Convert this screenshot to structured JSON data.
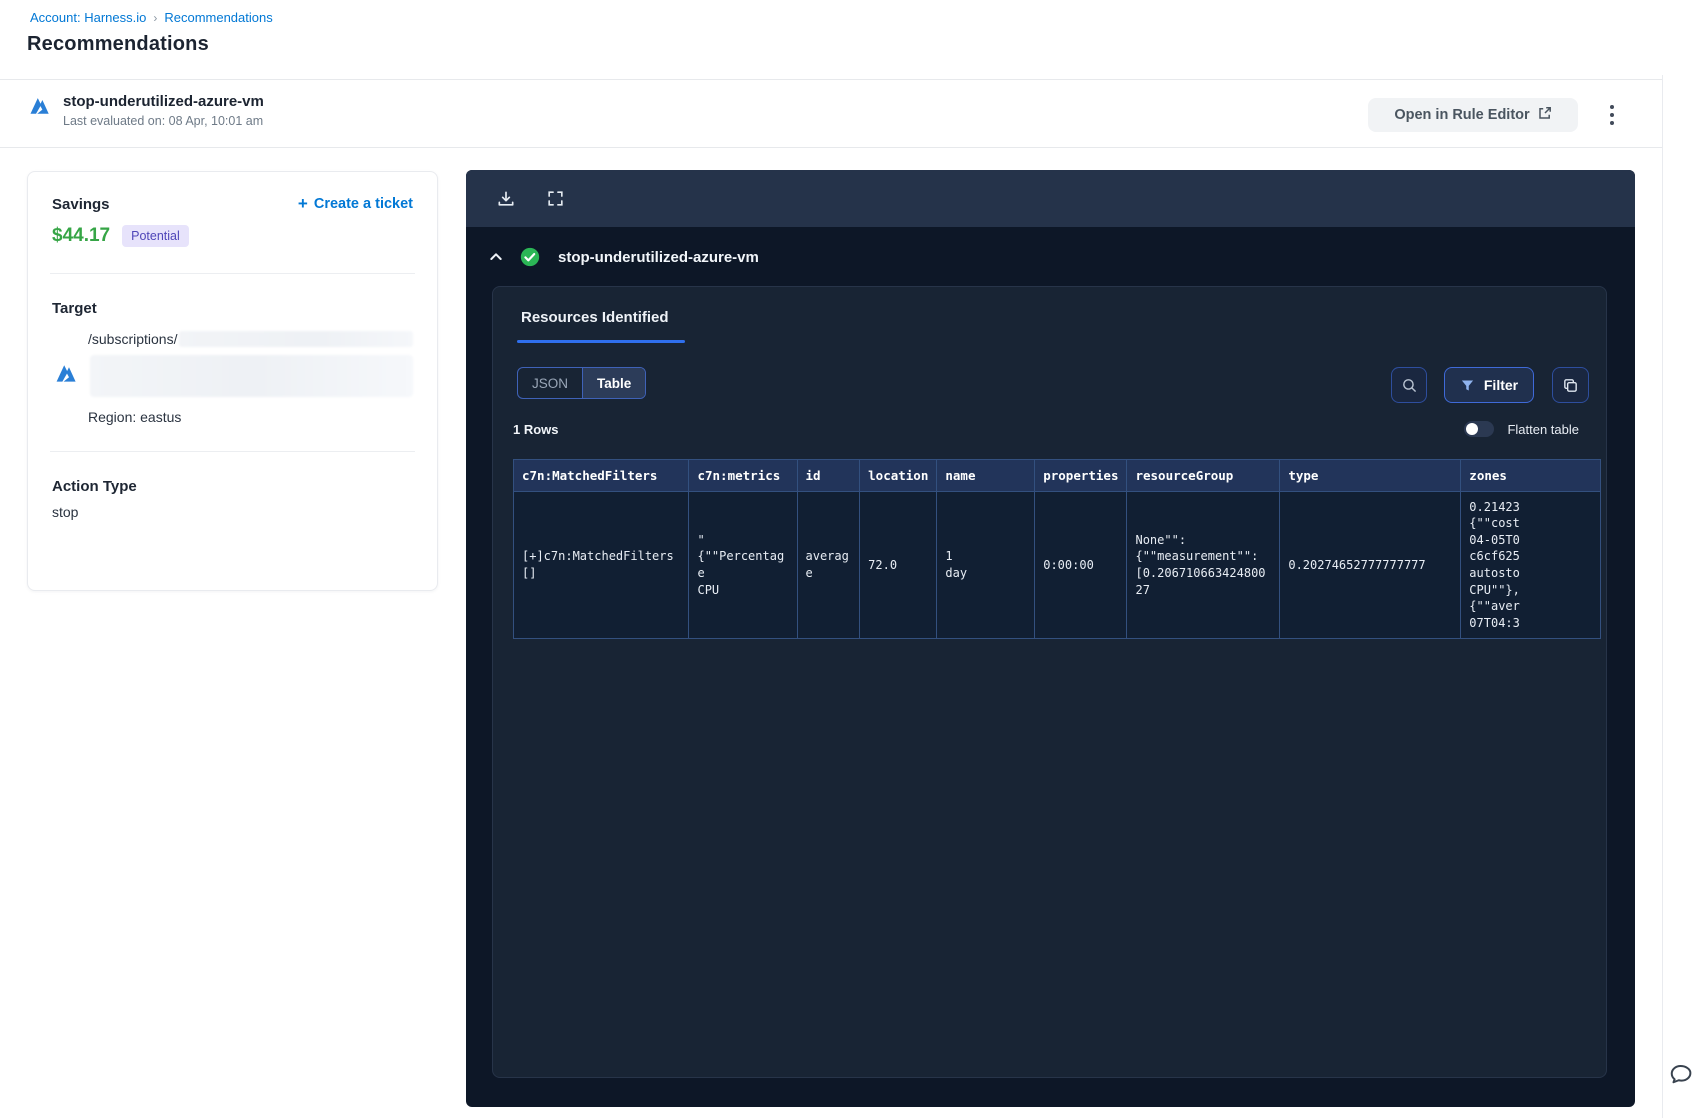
{
  "breadcrumb": {
    "account": "Account: Harness.io",
    "separator": "›",
    "current": "Recommendations"
  },
  "page": {
    "title": "Recommendations"
  },
  "header": {
    "name": "stop-underutilized-azure-vm",
    "last_evaluated": "Last evaluated on: 08 Apr, 10:01 am",
    "open_rule_editor": "Open in Rule Editor"
  },
  "savings_card": {
    "savings_label": "Savings",
    "amount": "$44.17",
    "badge": "Potential",
    "create_ticket_label": "Create a ticket",
    "target_label": "Target",
    "target_path": "/subscriptions/",
    "region": "Region: eastus",
    "action_type_label": "Action Type",
    "action_type_value": "stop"
  },
  "panel": {
    "title": "stop-underutilized-azure-vm",
    "tab": "Resources Identified",
    "view_toggle": {
      "json": "JSON",
      "table": "Table"
    },
    "filter_label": "Filter",
    "rows_count": "1 Rows",
    "flatten_label": "Flatten table",
    "table": {
      "columns": [
        "c7n:MatchedFilters",
        "c7n:metrics",
        "id",
        "location",
        "name",
        "properties",
        "resourceGroup",
        "type",
        "zones"
      ],
      "row": {
        "matched_filters": "[+]c7n:MatchedFilters[]",
        "metrics": "\"\n{\"\"Percentage\nCPU",
        "id": "average",
        "location": "72.0",
        "name": "1\nday",
        "properties": "0:00:00",
        "resource_group": "None\"\":\n{\"\"measurement\"\":\n[0.20671066342480027",
        "type": "0.20274652777777777",
        "zones": "0.21423\n{\"\"cost\n04-05T0\nc6cf625\nautosto\nCPU\"\"},\n{\"\"aver\n07T04:3"
      }
    }
  },
  "colors": {
    "accent_blue": "#0278d5",
    "savings_green": "#36a546",
    "badge_bg": "#e7e3fb",
    "badge_text": "#4f46b8",
    "tab_underline": "#2f6fed",
    "link_cell": "#74b7dc",
    "check_green": "#2bb656"
  }
}
